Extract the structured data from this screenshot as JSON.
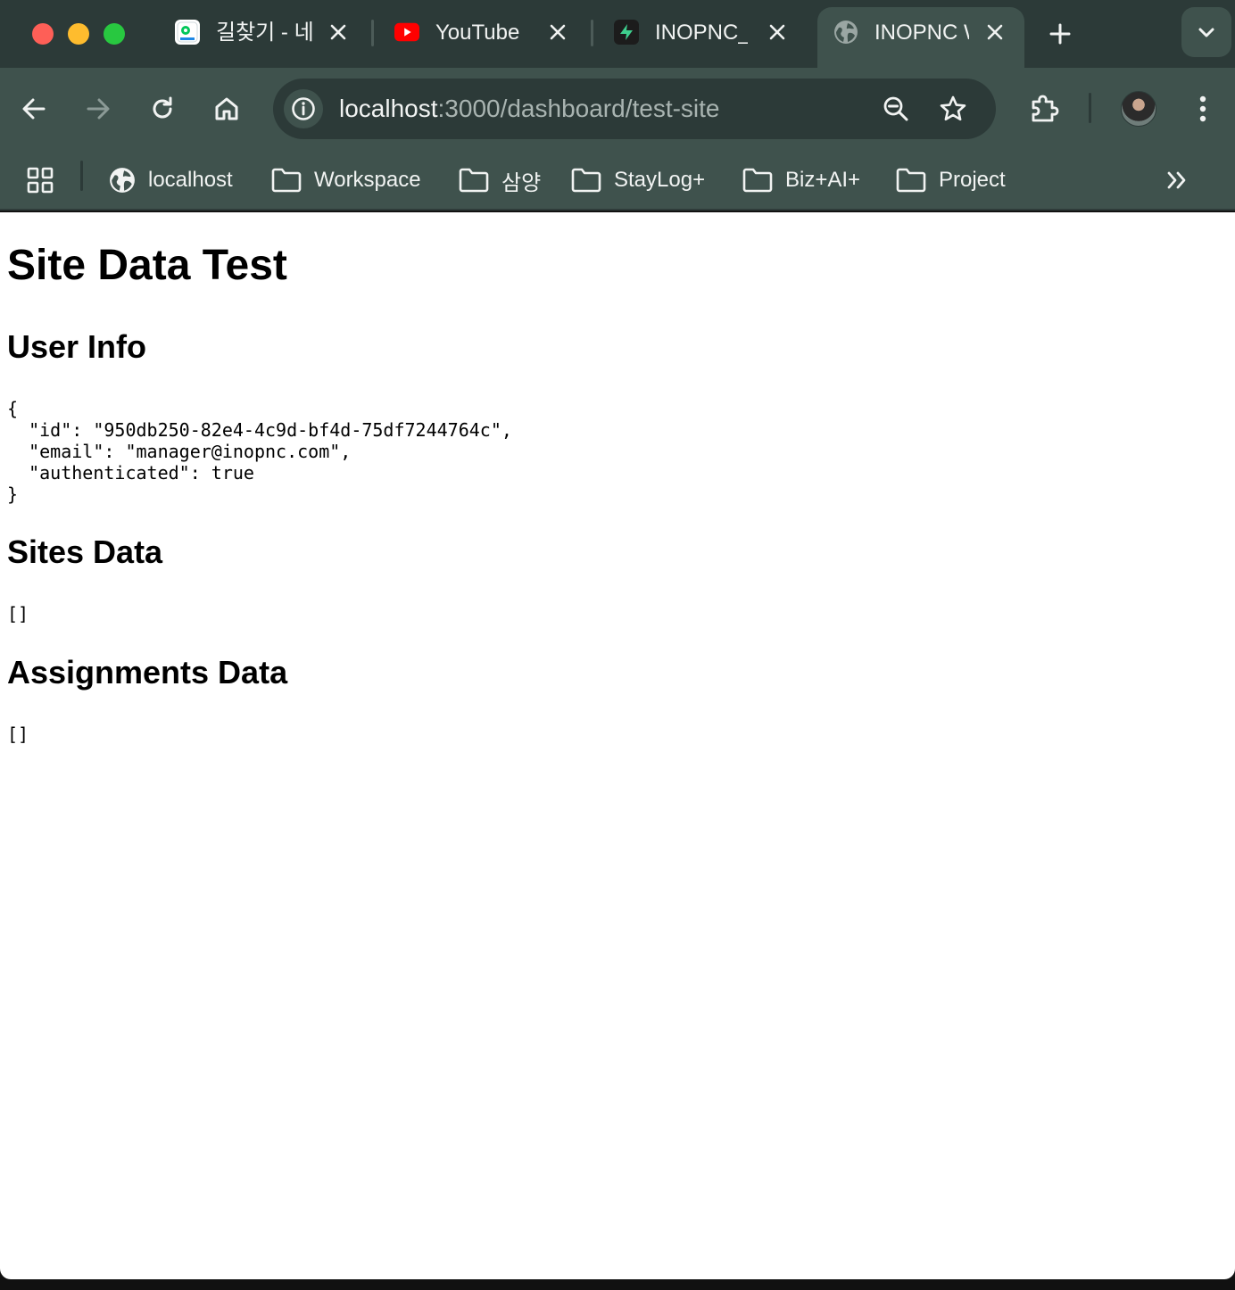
{
  "browser": {
    "tabs": [
      {
        "title": "길찾기 - 네",
        "favicon": "naver-map-icon",
        "active": false
      },
      {
        "title": "YouTube",
        "favicon": "youtube-icon",
        "active": false
      },
      {
        "title": "INOPNC_",
        "favicon": "supabase-icon",
        "active": false
      },
      {
        "title": "INOPNC W",
        "favicon": "globe-icon",
        "active": true
      }
    ],
    "address_bar": {
      "host": "localhost",
      "path": ":3000/dashboard/test-site"
    },
    "bookmarks": [
      {
        "label": "localhost",
        "icon": "globe-icon"
      },
      {
        "label": "Workspace",
        "icon": "folder-icon"
      },
      {
        "label": "삼양",
        "icon": "folder-icon"
      },
      {
        "label": "StayLog+",
        "icon": "folder-icon"
      },
      {
        "label": "Biz+AI+",
        "icon": "folder-icon"
      },
      {
        "label": "Project",
        "icon": "folder-icon"
      }
    ],
    "colors": {
      "frame": "#2c3a38",
      "toolbar": "#3f524d"
    }
  },
  "page": {
    "title": "Site Data Test",
    "user_section": {
      "heading": "User Info",
      "json": "{\n  \"id\": \"950db250-82e4-4c9d-bf4d-75df7244764c\",\n  \"email\": \"manager@inopnc.com\",\n  \"authenticated\": true\n}"
    },
    "sites_section": {
      "heading": "Sites Data",
      "json": "[]"
    },
    "assignments_section": {
      "heading": "Assignments Data",
      "json": "[]"
    }
  }
}
